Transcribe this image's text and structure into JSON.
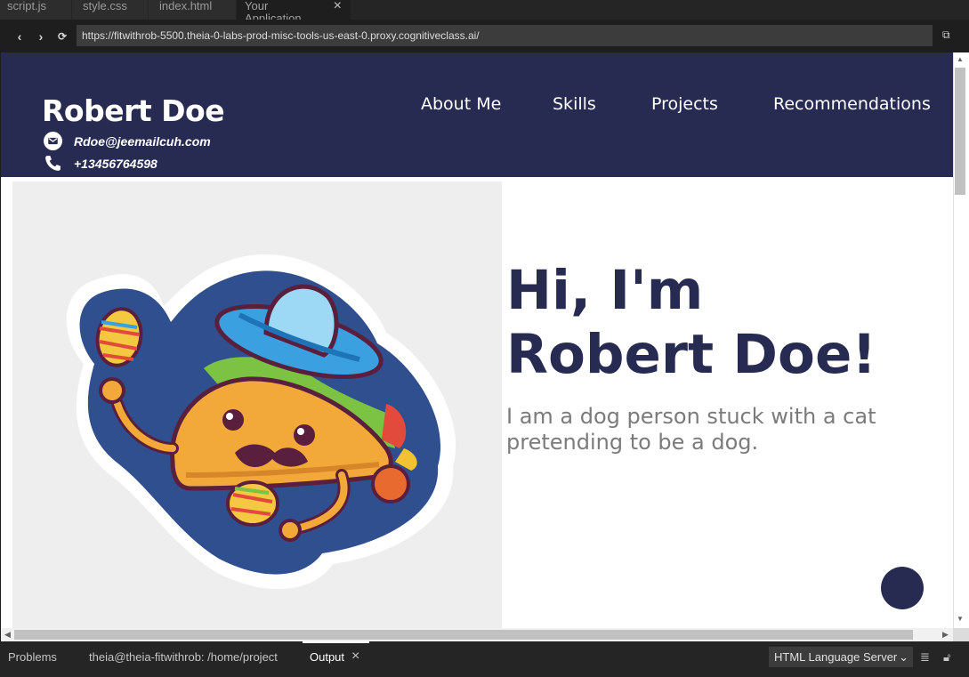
{
  "tabs": [
    {
      "label": "script.js"
    },
    {
      "label": "style.css"
    },
    {
      "label": "index.html"
    },
    {
      "label": "Your Application",
      "close": "×"
    }
  ],
  "navbar": {
    "back": "‹",
    "forward": "›",
    "reload": "⟳",
    "url": "https://fitwithrob-5500.theia-0-labs-prod-misc-tools-us-east-0.proxy.cognitiveclass.ai/",
    "external": "⧉"
  },
  "site": {
    "name": "Robert Doe",
    "email": "Rdoe@jeemailcuh.com",
    "phone": "+13456764598",
    "menu": [
      "About Me",
      "Skills",
      "Projects",
      "Recommendations"
    ],
    "hero_title": "Hi, I'm Robert Doe!",
    "hero_subtitle": "I am a dog person stuck with a cat pretending to be a dog."
  },
  "panel": {
    "tabs": [
      "Problems",
      "theia@theia-fitwithrob: /home/project",
      "Output"
    ],
    "output_close": "×",
    "select_value": "HTML Language Server"
  },
  "colors": {
    "header_bg": "#272b52",
    "accent": "#272b52",
    "subtitle": "#7b7b7b",
    "image_bg": "#eeeeee"
  }
}
